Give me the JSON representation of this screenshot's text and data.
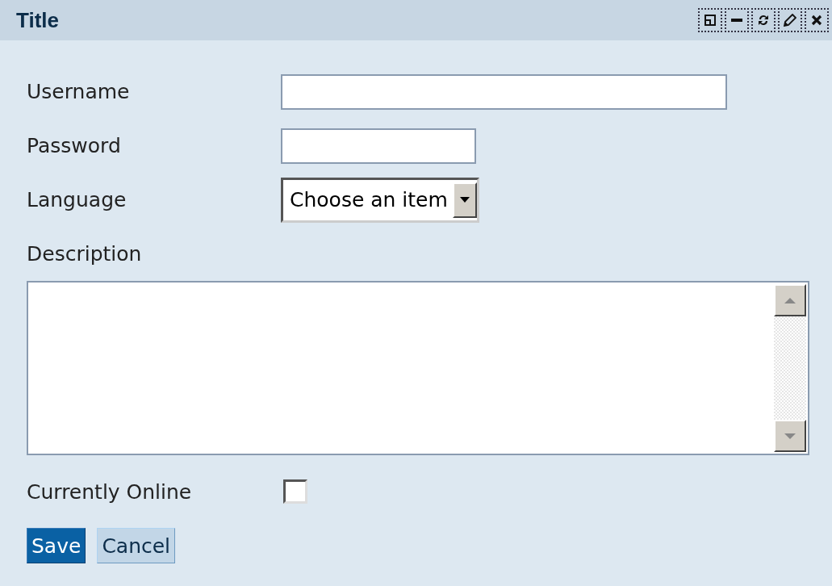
{
  "window": {
    "title": "Title"
  },
  "fields": [
    {
      "kind": "text",
      "label": "Username"
    },
    {
      "kind": "password",
      "label": "Password"
    },
    {
      "kind": "select",
      "label": "Language",
      "value": "Choose an item"
    },
    {
      "kind": "textarea",
      "label": "Description"
    },
    {
      "kind": "checkbox",
      "label": "Currently Online",
      "checked": false
    }
  ],
  "buttons": [
    {
      "label": "Save",
      "primary": true
    },
    {
      "label": "Cancel",
      "primary": false
    }
  ]
}
